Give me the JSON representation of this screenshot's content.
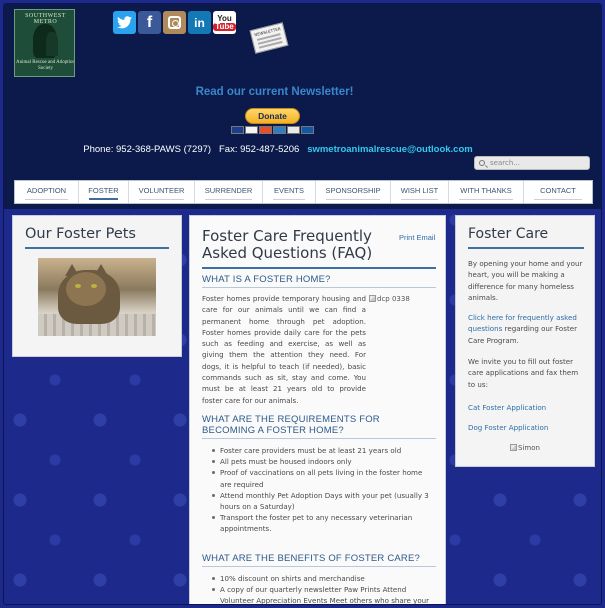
{
  "logo": {
    "arc_text": "SOUTHWEST METRO",
    "sub_text": "Animal Rescue and Adoption Society"
  },
  "social": [
    "twitter-icon",
    "facebook-icon",
    "instagram-icon",
    "linkedin-icon",
    "youtube-icon"
  ],
  "newsletter_icon_label": "NEWSLETTER",
  "read_newsletter": "Read our current Newsletter!",
  "donate_label": "Donate",
  "contact": {
    "phone": "Phone: 952-368-PAWS (7297)",
    "fax": "Fax: 952-487-5206",
    "email": "swmetroanimalrescue@outlook.com"
  },
  "search": {
    "placeholder": "search..."
  },
  "nav": [
    {
      "label": "ADOPTION",
      "active": false
    },
    {
      "label": "FOSTER",
      "active": true
    },
    {
      "label": "VOLUNTEER",
      "active": false
    },
    {
      "label": "SURRENDER",
      "active": false
    },
    {
      "label": "EVENTS",
      "active": false
    },
    {
      "label": "SPONSORSHIP",
      "active": false
    },
    {
      "label": "WISH LIST",
      "active": false
    },
    {
      "label": "WITH THANKS",
      "active": false
    },
    {
      "label": "CONTACT",
      "active": false
    }
  ],
  "left": {
    "title": "Our Foster Pets"
  },
  "center": {
    "title": "Foster Care Frequently Asked Questions (FAQ)",
    "print_email": "Print Email",
    "h1": "WHAT IS A FOSTER HOME?",
    "img_alt": "dcp 0338",
    "p1": "Foster homes provide temporary housing and care for our animals until we can find a permanent home through pet adoption. Foster homes provide daily care for the pets such as feeding and exercise, as well as giving them the attention they need. For dogs, it is helpful to teach (if needed), basic commands such as sit, stay and come. You must be at least 21 years old to provide foster care for our animals.",
    "h2": "WHAT ARE THE REQUIREMENTS FOR BECOMING A FOSTER HOME?",
    "req": [
      "Foster care providers must be at least 21 years old",
      "All pets must be housed indoors only",
      "Proof of vaccinations on all pets living in the foster home are required",
      "Attend monthly Pet Adoption Days with your pet (usually 3 hours on a Saturday)",
      "Transport the foster pet to any necessary veterinarian appointments."
    ],
    "h3": "WHAT ARE THE BENEFITS OF FOSTER CARE?",
    "benefits": [
      "10% discount on shirts and merchandise",
      "A copy of our quarterly newsletter Paw Prints Attend Volunteer Appreciation Events Meet others who share your love for"
    ]
  },
  "right": {
    "title": "Foster Care",
    "p1": "By opening your home and your heart, you will be making a difference for many homeless animals.",
    "p2_link": "Click here for frequently asked questions",
    "p2_rest": " regarding our Foster Care Program.",
    "p3": "We invite you to fill out foster care applications and fax them to us:",
    "cat_app": "Cat Foster Application",
    "dog_app": "Dog Foster Application",
    "simon_alt": "Simon"
  },
  "colors": {
    "page_bg": "#1d2a8c",
    "header_bg": "#0b1a4b",
    "accent": "#3d6fa3",
    "link": "#2d6ea8",
    "email": "#35c9f0"
  }
}
